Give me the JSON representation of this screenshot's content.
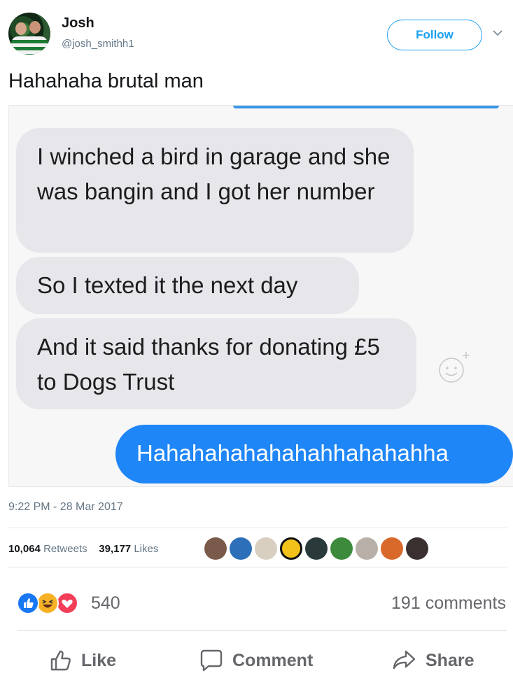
{
  "tweet": {
    "display_name": "Josh",
    "handle": "@josh_smithh1",
    "follow_label": "Follow",
    "text": "Hahahaha brutal man",
    "timestamp": "9:22 PM - 28 Mar 2017",
    "retweets_count": "10,064",
    "retweets_label": "Retweets",
    "likes_count": "39,177",
    "likes_label": "Likes"
  },
  "messages": [
    {
      "text": "I winched a bird in garage and she was bangin and I got her number",
      "from": "received"
    },
    {
      "text": "So I texted it the next day",
      "from": "received"
    },
    {
      "text": "And it said thanks for donating £5 to Dogs Trust",
      "from": "received"
    },
    {
      "text": "Hahahahahahahahhahahahha",
      "from": "sent"
    }
  ],
  "facebook": {
    "reaction_count": "540",
    "comments_count": "191 comments",
    "like_label": "Like",
    "comment_label": "Comment",
    "share_label": "Share"
  },
  "colors": {
    "twitter_blue": "#1da1f2",
    "imessage_blue": "#1f86f7",
    "bubble_gray": "#e6e6eb",
    "fb_like_blue": "#1877f2",
    "fb_love_red": "#f33e58",
    "fb_haha_yellow": "#f7b125"
  }
}
